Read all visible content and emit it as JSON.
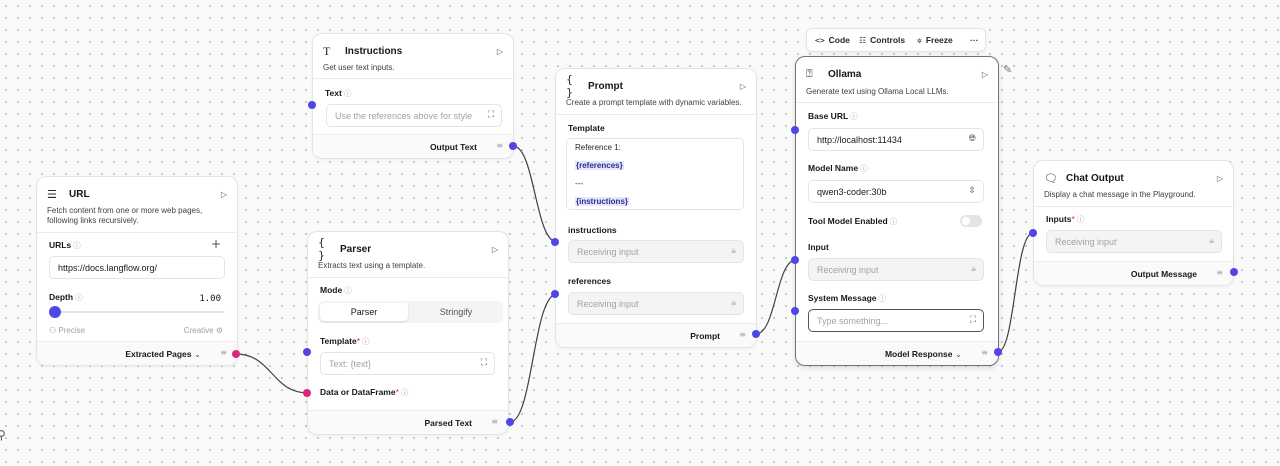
{
  "toolbar": {
    "code": "Code",
    "controls": "Controls",
    "freeze": "Freeze",
    "more": "···"
  },
  "url_node": {
    "title": "URL",
    "description": "Fetch content from one or more web pages, following links recursively.",
    "urls_label": "URLs",
    "url_value": "https://docs.langflow.org/",
    "depth_label": "Depth",
    "depth_value": "1.00",
    "depth_slider_fraction": 0,
    "slider_min_label": "Precise",
    "slider_max_label": "Creative",
    "output": "Extracted Pages"
  },
  "instructions_node": {
    "title": "Instructions",
    "description": "Get user text inputs.",
    "text_label": "Text",
    "text_placeholder": "Use the references above for style",
    "output": "Output Text"
  },
  "parser_node": {
    "title": "Parser",
    "description": "Extracts text using a template.",
    "mode_label": "Mode",
    "mode_options": [
      "Parser",
      "Stringify"
    ],
    "mode_selected": "Parser",
    "template_label": "Template",
    "template_placeholder": "Text: {text}",
    "data_label": "Data or DataFrame",
    "output": "Parsed Text"
  },
  "prompt_node": {
    "title": "Prompt",
    "description": "Create a prompt template with dynamic variables.",
    "template_label": "Template",
    "template_lines": [
      "Reference 1:",
      "{references}",
      "---",
      "{instructions}"
    ],
    "instructions_label": "instructions",
    "references_label": "references",
    "receiving": "Receiving input",
    "output": "Prompt"
  },
  "ollama_node": {
    "title": "Ollama",
    "description": "Generate text using Ollama Local LLMs.",
    "base_url_label": "Base URL",
    "base_url_value": "http://localhost:11434",
    "model_name_label": "Model Name",
    "model_name_value": "qwen3-coder:30b",
    "tool_model_label": "Tool Model Enabled",
    "tool_model_enabled": false,
    "input_label": "Input",
    "input_receiving": "Receiving input",
    "system_message_label": "System Message",
    "system_message_placeholder": "Type something...",
    "output": "Model Response"
  },
  "chat_output_node": {
    "title": "Chat Output",
    "description": "Display a chat message in the Playground.",
    "inputs_label": "Inputs",
    "inputs_receiving": "Receiving input",
    "output": "Output Message"
  },
  "colors": {
    "handle": "#4f46e5",
    "handle_data": "#db2777",
    "edge": "#3f3f46"
  }
}
